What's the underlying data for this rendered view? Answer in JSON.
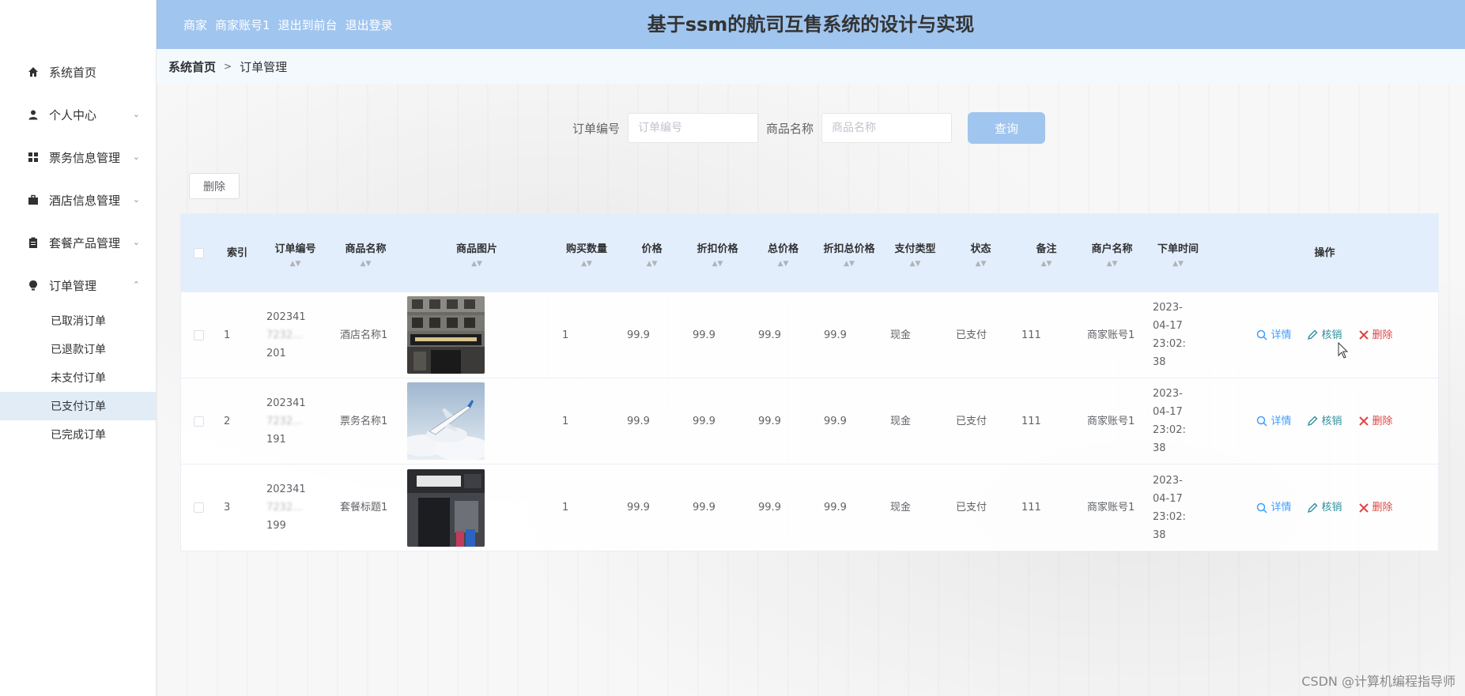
{
  "header": {
    "role": "商家",
    "user": "商家账号1",
    "to_front": "退出到前台",
    "logout": "退出登录",
    "title": "基于ssm的航司互售系统的设计与实现"
  },
  "sidebar": {
    "items": [
      {
        "label": "系统首页"
      },
      {
        "label": "个人中心"
      },
      {
        "label": "票务信息管理"
      },
      {
        "label": "酒店信息管理"
      },
      {
        "label": "套餐产品管理"
      },
      {
        "label": "订单管理"
      }
    ],
    "sub_items": [
      {
        "label": "已取消订单"
      },
      {
        "label": "已退款订单"
      },
      {
        "label": "未支付订单"
      },
      {
        "label": "已支付订单"
      },
      {
        "label": "已完成订单"
      }
    ]
  },
  "breadcrumb": {
    "home": "系统首页",
    "sep": ">",
    "current": "订单管理"
  },
  "search": {
    "order_label": "订单编号",
    "order_placeholder": "订单编号",
    "product_label": "商品名称",
    "product_placeholder": "商品名称",
    "query_btn": "查询"
  },
  "toolbar": {
    "delete_label": "删除"
  },
  "table": {
    "headers": {
      "idx": "索引",
      "order_no": "订单编号",
      "product_name": "商品名称",
      "product_img": "商品图片",
      "qty": "购买数量",
      "price": "价格",
      "discount_price": "折扣价格",
      "total_price": "总价格",
      "discount_total": "折扣总价格",
      "pay_type": "支付类型",
      "status": "状态",
      "note": "备注",
      "merchant": "商户名称",
      "order_time": "下单时间",
      "ops": "操作"
    },
    "ops_labels": {
      "detail": "详情",
      "cancel": "核销",
      "remove": "删除"
    },
    "rows": [
      {
        "idx": "1",
        "order_no": "202341 ...201",
        "order_no_l1": "202341",
        "order_no_l2": "7232...",
        "order_no_l3": "201",
        "product_name": "酒店名称1",
        "qty": "1",
        "price": "99.9",
        "discount_price": "99.9",
        "total_price": "99.9",
        "discount_total": "99.9",
        "pay_type": "现金",
        "status": "已支付",
        "note": "111",
        "merchant": "商家账号1",
        "time_l1": "2023-",
        "time_l2": "04-17",
        "time_l3": "23:02:",
        "time_l4": "38",
        "img": "hotel"
      },
      {
        "idx": "2",
        "order_no_l1": "202341",
        "order_no_l2": "7232...",
        "order_no_l3": "191",
        "product_name": "票务名称1",
        "qty": "1",
        "price": "99.9",
        "discount_price": "99.9",
        "total_price": "99.9",
        "discount_total": "99.9",
        "pay_type": "现金",
        "status": "已支付",
        "note": "111",
        "merchant": "商家账号1",
        "time_l1": "2023-",
        "time_l2": "04-17",
        "time_l3": "23:02:",
        "time_l4": "38",
        "img": "plane"
      },
      {
        "idx": "3",
        "order_no_l1": "202341",
        "order_no_l2": "7232...",
        "order_no_l3": "199",
        "product_name": "套餐标题1",
        "qty": "1",
        "price": "99.9",
        "discount_price": "99.9",
        "total_price": "99.9",
        "discount_total": "99.9",
        "pay_type": "现金",
        "status": "已支付",
        "note": "111",
        "merchant": "商家账号1",
        "time_l1": "2023-",
        "time_l2": "04-17",
        "time_l3": "23:02:",
        "time_l4": "38",
        "img": "storefront"
      }
    ]
  },
  "watermark": "CSDN @计算机编程指导师",
  "colors": {
    "accent": "#a0c5ef",
    "detail": "#409eff",
    "cancel": "#2f8f9d",
    "remove": "#e04545"
  }
}
